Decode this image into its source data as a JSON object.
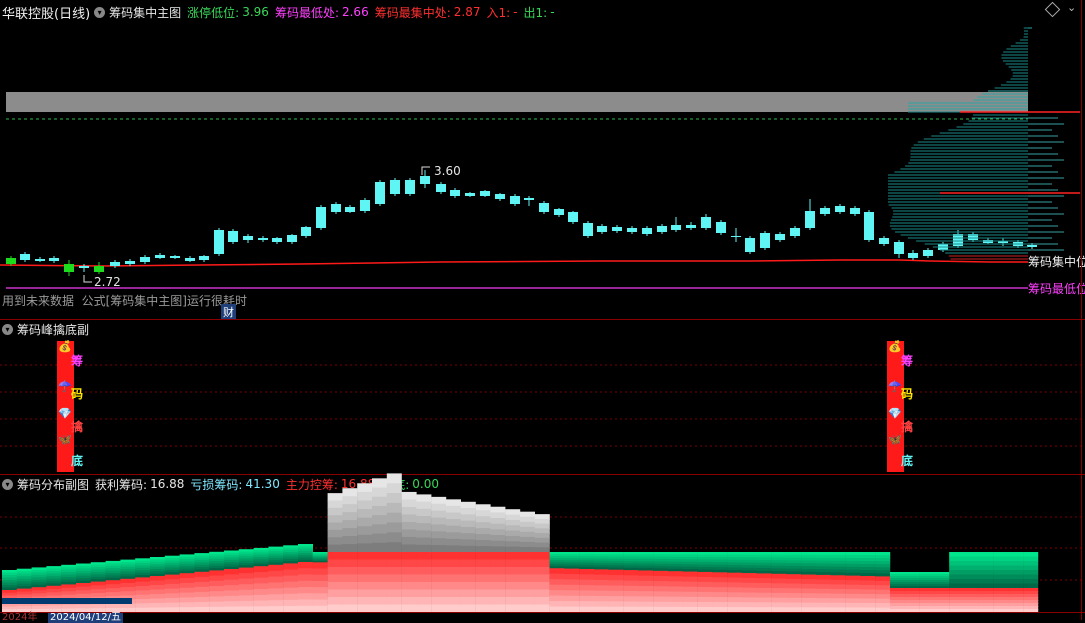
{
  "panel1": {
    "stock_title": "华联控股(日线)",
    "indicator_name": "筹码集中主图",
    "items": [
      {
        "label": "涨停低位:",
        "value": "3.96",
        "color": "#39d85a"
      },
      {
        "label": "筹码最低处:",
        "value": "2.66",
        "color": "#ff40ff"
      },
      {
        "label": "筹码最集中处:",
        "value": "2.87",
        "color": "#ff3030"
      },
      {
        "label": "入1:",
        "value": "-",
        "color": "#ff3030"
      },
      {
        "label": "出1:",
        "value": "-",
        "color": "#39d85a"
      }
    ],
    "high_label": "3.60",
    "low_label": "2.72",
    "line_label_1": "筹码集中位",
    "line_label_2": "筹码最低位",
    "warning_text": "用到未来数据  公式[筹码集中主图]运行很耗时",
    "finance_mark": "财"
  },
  "panel2": {
    "indicator_name": "筹码峰擒底副",
    "stack_chars": [
      "筹",
      "码",
      "擒",
      "底"
    ],
    "stack_icons": [
      "money-bag",
      "umbrella",
      "gem",
      "butterfly"
    ]
  },
  "panel3": {
    "indicator_name": "筹码分布副图",
    "items": [
      {
        "label": "获利筹码:",
        "value": "16.88",
        "color": "#e6e6e6"
      },
      {
        "label": "亏损筹码:",
        "value": "41.30",
        "color": "#7fe8ff"
      },
      {
        "label": "主力控筹:",
        "value": "16.88",
        "color": "#ff3030"
      },
      {
        "label": "抄底:",
        "value": "0.00",
        "color": "#39d85a"
      }
    ]
  },
  "axis": {
    "date_labels": [
      "2024年",
      "2024/04/12/五"
    ]
  },
  "colors": {
    "up": "#ff3333",
    "down": "#5ff5f5",
    "line": "#ff1a1a",
    "magenta": "#cc33cc"
  }
}
